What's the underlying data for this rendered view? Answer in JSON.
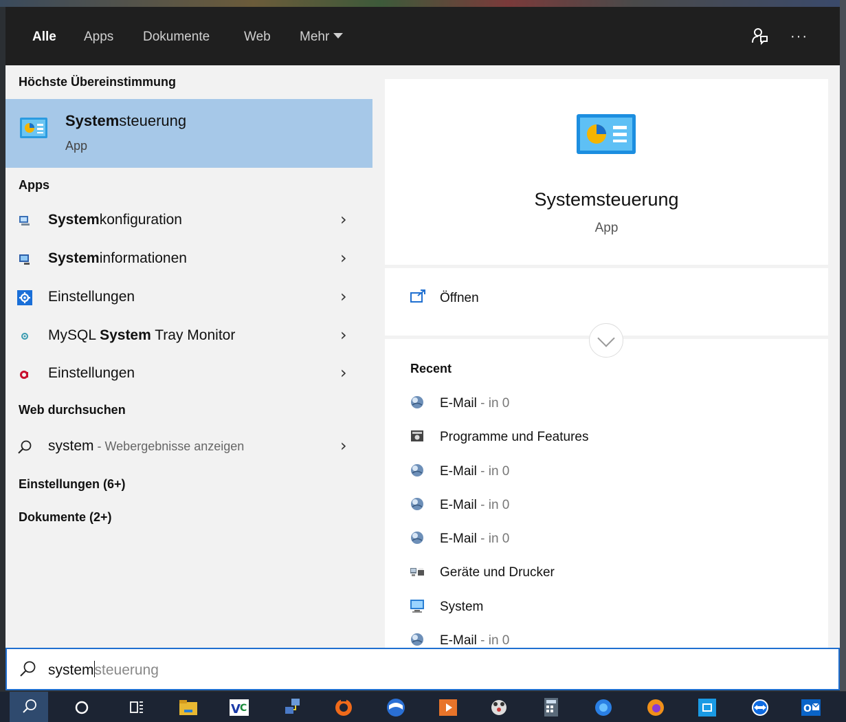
{
  "tabs": [
    {
      "label": "Alle",
      "active": true
    },
    {
      "label": "Apps",
      "active": false
    },
    {
      "label": "Dokumente",
      "active": false
    },
    {
      "label": "Web",
      "active": false
    },
    {
      "label": "Mehr",
      "active": false
    }
  ],
  "top_icons": {
    "feedback": "feedback-icon",
    "more": "···"
  },
  "left": {
    "best_match_heading": "Höchste Übereinstimmung",
    "best_match": {
      "title_bold": "System",
      "title_rest": "steuerung",
      "subtitle": "App",
      "icon": "control-panel-icon"
    },
    "apps_heading": "Apps",
    "apps": [
      {
        "bold": "System",
        "rest": "konfiguration",
        "icon": "system-config-icon"
      },
      {
        "bold": "System",
        "rest": "informationen",
        "icon": "system-info-icon"
      },
      {
        "bold": "",
        "rest": "Einstellungen",
        "icon": "settings-gear-icon"
      },
      {
        "pre": "MySQL ",
        "bold": "System",
        "rest": " Tray Monitor",
        "icon": "mysql-icon"
      },
      {
        "bold": "",
        "rest": "Einstellungen",
        "icon": "app-a-icon"
      }
    ],
    "web_heading": "Web durchsuchen",
    "web": {
      "query": "system",
      "suffix": " - Webergebnisse anzeigen"
    },
    "settings_heading": "Einstellungen (6+)",
    "documents_heading": "Dokumente (2+)"
  },
  "right": {
    "title": "Systemsteuerung",
    "subtitle": "App",
    "open_label": "Öffnen",
    "recent_heading": "Recent",
    "recent": [
      {
        "label": "E-Mail",
        "sub": " - in 0",
        "icon": "mail-globe-icon"
      },
      {
        "label": "Programme und Features",
        "sub": "",
        "icon": "programs-icon"
      },
      {
        "label": "E-Mail",
        "sub": " - in 0",
        "icon": "mail-globe-icon"
      },
      {
        "label": "E-Mail",
        "sub": " - in 0",
        "icon": "mail-globe-icon"
      },
      {
        "label": "E-Mail",
        "sub": " - in 0",
        "icon": "mail-globe-icon"
      },
      {
        "label": "Geräte und Drucker",
        "sub": "",
        "icon": "devices-printers-icon"
      },
      {
        "label": "System",
        "sub": "",
        "icon": "system-monitor-icon"
      },
      {
        "label": "E-Mail",
        "sub": " - in 0",
        "icon": "mail-globe-icon"
      }
    ]
  },
  "search": {
    "typed": "system",
    "suggestion": "steuerung"
  },
  "taskbar": [
    "search-icon",
    "cortana-icon",
    "task-view-icon",
    "file-explorer-icon",
    "visual-studio-code-icon",
    "network-app-icon",
    "app-orange-icon",
    "app-blue-icon",
    "media-player-icon",
    "app-mascot-icon",
    "calculator-icon",
    "firefox-dev-icon",
    "firefox-icon",
    "app-teal-icon",
    "teamviewer-icon",
    "outlook-icon"
  ],
  "colors": {
    "accent": "#1f6fd0",
    "selected": "#a6c8e8",
    "topbar": "#1f1f1f",
    "taskbar": "#1c2433"
  }
}
